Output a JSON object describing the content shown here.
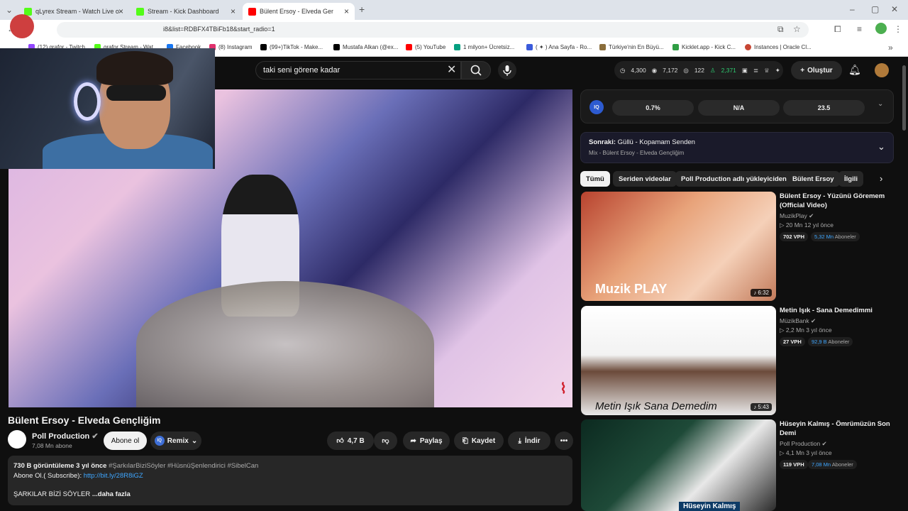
{
  "browser": {
    "tabs": [
      {
        "title": "qLyrex Stream - Watch Live on",
        "color": "#53fc18"
      },
      {
        "title": "Stream - Kick Dashboard",
        "color": "#53fc18"
      },
      {
        "title": "Bülent Ersoy - Elveda Gençliğ",
        "color": "#ff0000"
      }
    ],
    "new_tab": "+",
    "url": "i8&list=RDBFX4TBiFb18&start_radio=1",
    "bookmarks": [
      {
        "label": "(12) qrafor - Twitch",
        "color": "#9146ff"
      },
      {
        "label": "qrafor Stream - Wat...",
        "color": "#53fc18"
      },
      {
        "label": "Facebook",
        "color": "#1877f2"
      },
      {
        "label": "(8) Instagram",
        "color": "#e1306c"
      },
      {
        "label": "(99+)TikTok - Make...",
        "color": "#000000"
      },
      {
        "label": "Mustafa Alkan (@ex...",
        "color": "#000000"
      },
      {
        "label": "(5) YouTube",
        "color": "#ff0000"
      },
      {
        "label": "1 milyon+ Ücretsiz...",
        "color": "#05a081"
      },
      {
        "label": "( ✦ ) Ana Sayfa - Ro...",
        "color": "#3b5bdb"
      },
      {
        "label": "Türkiye'nin En Büyü...",
        "color": "#8a6d3b"
      },
      {
        "label": "Kicklet.app - Kick C...",
        "color": "#2f9e44"
      },
      {
        "label": "Instances | Oracle Cl...",
        "color": "#c74634"
      }
    ]
  },
  "youtube": {
    "search_value": "taki seni görene kadar",
    "stats": {
      "watch_time": "4,300",
      "views": "7,172",
      "watching": "122",
      "growth": "2,371"
    },
    "create_label": "Oluştur",
    "video_title": "Bülent Ersoy - Elveda Gençliğim",
    "channel": {
      "name": "Poll Production",
      "subs": "7,08 Mn abone"
    },
    "subscribe_label": "Abone ol",
    "remix_label": "Remix",
    "like_count": "4,7 B",
    "share_label": "Paylaş",
    "save_label": "Kaydet",
    "download_label": "İndir",
    "more_label": "•••",
    "description": {
      "views_date": "730 B görüntüleme  3 yıl önce",
      "tags": "#ŞarkılarBiziSöyler #HüsnüŞenlendirici #SibelCan",
      "subscribe_text": "Abone Ol.( Subscribe):",
      "link": "http://bit.ly/28R8iGZ",
      "line3": "ŞARKILAR BİZİ SÖYLER",
      "more": "...daha fazla"
    },
    "iq": {
      "badge": "IQ",
      "cells": [
        "0.7%",
        "N/A",
        "23.5"
      ]
    },
    "next": {
      "label": "Sonraki:",
      "title": "Güllü - Kopamam Senden",
      "sub": "Mix - Bülent Ersoy - Elveda Gençliğim"
    },
    "chips": [
      "Tümü",
      "Seriden videolar",
      "Poll Production adlı yükleyiciden",
      "Bülent Ersoy",
      "İlgili"
    ],
    "recs": [
      {
        "title": "Bülent Ersoy - Yüzünü Göremem (Official Video)",
        "channel": "MuzikPlay",
        "meta": "▷ 20 Mn  12 yıl önce",
        "vph": "702 VPH",
        "subs": "5,32 Mn",
        "subs_label": "Aboneler",
        "duration": "♪ 6:32",
        "overlay": "Muzik PLAY"
      },
      {
        "title": "Metin Işık - Sana Demedimmi",
        "channel": "MüzikBank",
        "meta": "▷ 2,2 Mn  3 yıl önce",
        "vph": "27 VPH",
        "subs": "92,9 B",
        "subs_label": "Aboneler",
        "duration": "♪ 5:43",
        "overlay": "Metin Işık  Sana Demedim"
      },
      {
        "title": "Hüseyin Kalmış - Ömrümüzün Son Demi",
        "channel": "Poll Production",
        "meta": "▷ 4,1 Mn  3 yıl önce",
        "vph": "119 VPH",
        "subs": "7,08 Mn",
        "subs_label": "Aboneler",
        "duration": "",
        "overlay": "Hüseyin Kalmış"
      }
    ]
  }
}
